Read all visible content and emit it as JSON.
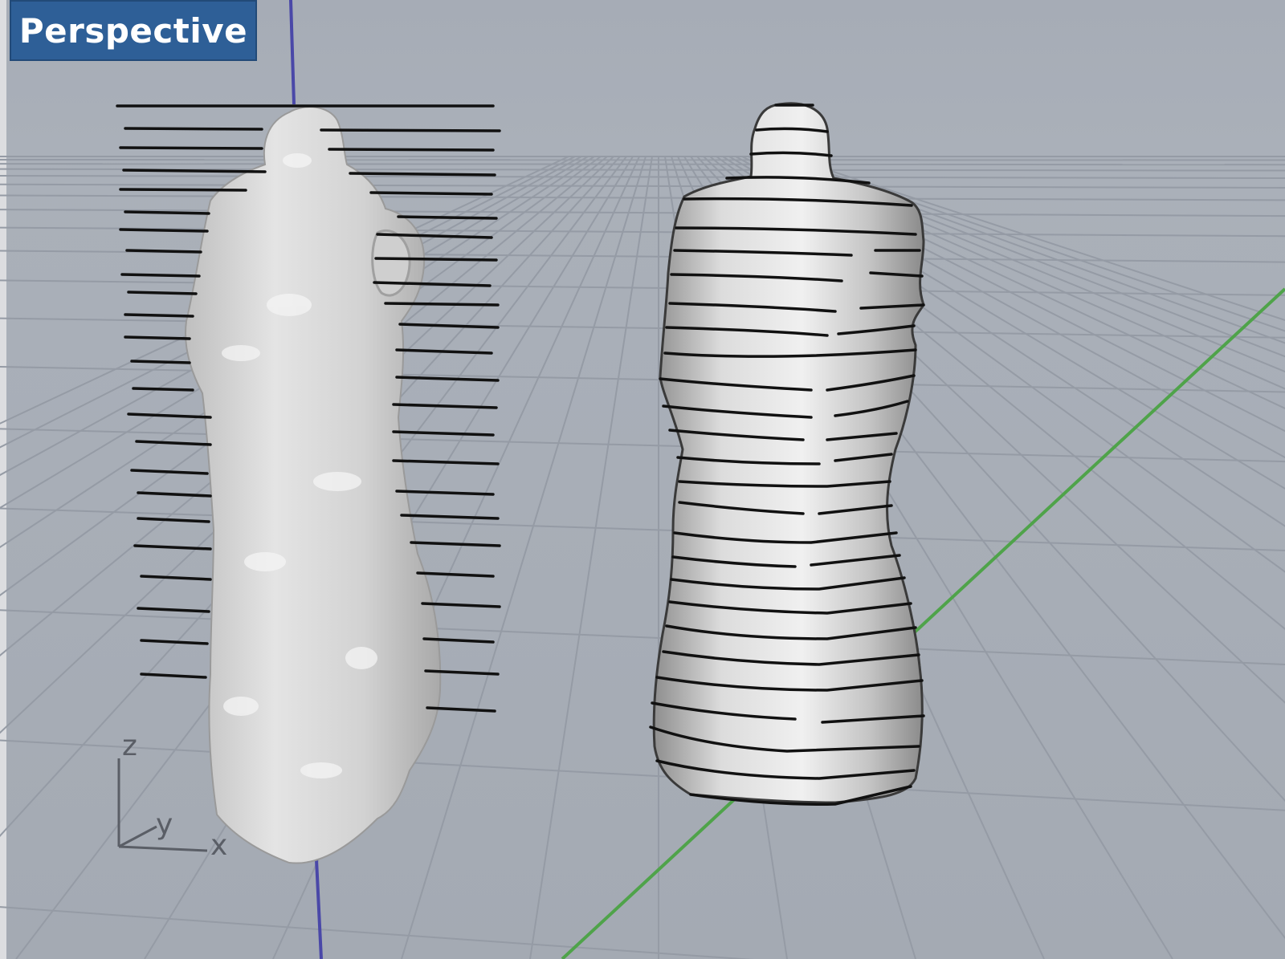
{
  "viewport": {
    "label": "Perspective",
    "background_color": "#a8aeb7",
    "grid_color": "#959ba5",
    "x_axis_color": "#4fa34a",
    "z_axis_color": "#4a48a8",
    "label_color": "#2e5f97"
  },
  "scene": {
    "objects": [
      {
        "name": "scanned mannequin torso mesh",
        "color": "#d6d6d6"
      },
      {
        "name": "smoothed mannequin torso surface",
        "color": "#cfcfcf"
      }
    ],
    "contour_lines_color": "#111111"
  },
  "gizmo": {
    "z_label": "z",
    "y_label": "y",
    "x_label": "x"
  }
}
